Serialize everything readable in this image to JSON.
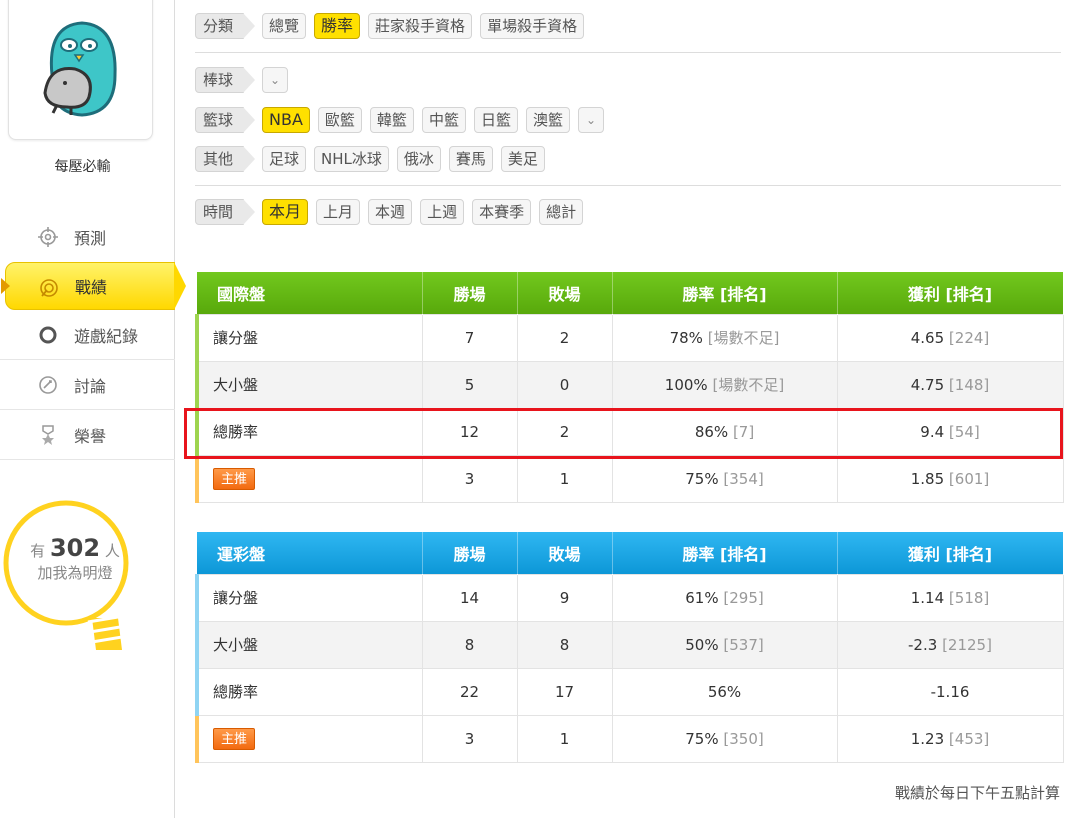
{
  "sidebar": {
    "username": "每壓必輸",
    "nav": [
      {
        "label": "預測",
        "icon": "crosshair-icon"
      },
      {
        "label": "戰績",
        "icon": "trophy-target-icon",
        "active": true
      },
      {
        "label": "遊戲紀錄",
        "icon": "circle-icon"
      },
      {
        "label": "討論",
        "icon": "chat-bubble-icon"
      },
      {
        "label": "榮譽",
        "icon": "medal-icon"
      }
    ],
    "bulb": {
      "prefix": "有",
      "count": "302",
      "suffix": "人",
      "line2": "加我為明燈"
    }
  },
  "filters": {
    "category": {
      "label": "分類",
      "chips": [
        "總覽",
        "勝率",
        "莊家殺手資格",
        "單場殺手資格"
      ],
      "selected": "勝率"
    },
    "baseball": {
      "label": "棒球"
    },
    "basketball": {
      "label": "籃球",
      "chips": [
        "NBA",
        "歐籃",
        "韓籃",
        "中籃",
        "日籃",
        "澳籃"
      ],
      "selected": "NBA"
    },
    "other": {
      "label": "其他",
      "chips": [
        "足球",
        "NHL冰球",
        "俄冰",
        "賽馬",
        "美足"
      ]
    },
    "time": {
      "label": "時間",
      "chips": [
        "本月",
        "上月",
        "本週",
        "上週",
        "本賽季",
        "總計"
      ],
      "selected": "本月"
    }
  },
  "colors": {
    "accent_yellow": "#ffe000",
    "green_header": "#5fb412",
    "blue_header": "#18a5e3",
    "highlight_red": "#e8141c"
  },
  "international": {
    "headers": [
      "國際盤",
      "勝場",
      "敗場",
      "勝率 [排名]",
      "獲利 [排名]"
    ],
    "rows": [
      {
        "name": "讓分盤",
        "win": "7",
        "loss": "2",
        "rate": "78%",
        "rate_rank": "[場數不足]",
        "profit": "4.65",
        "profit_rank": "[224]"
      },
      {
        "name": "大小盤",
        "win": "5",
        "loss": "0",
        "rate": "100%",
        "rate_rank": "[場數不足]",
        "profit": "4.75",
        "profit_rank": "[148]"
      },
      {
        "name": "總勝率",
        "win": "12",
        "loss": "2",
        "rate": "86%",
        "rate_rank": "[7]",
        "profit": "9.4",
        "profit_rank": "[54]"
      }
    ],
    "main_pick": {
      "badge": "主推",
      "win": "3",
      "loss": "1",
      "rate": "75%",
      "rate_rank": "[354]",
      "profit": "1.85",
      "profit_rank": "[601]"
    }
  },
  "sports_lottery": {
    "headers": [
      "運彩盤",
      "勝場",
      "敗場",
      "勝率 [排名]",
      "獲利 [排名]"
    ],
    "rows": [
      {
        "name": "讓分盤",
        "win": "14",
        "loss": "9",
        "rate": "61%",
        "rate_rank": "[295]",
        "profit": "1.14",
        "profit_rank": "[518]"
      },
      {
        "name": "大小盤",
        "win": "8",
        "loss": "8",
        "rate": "50%",
        "rate_rank": "[537]",
        "profit": "-2.3",
        "profit_rank": "[2125]"
      },
      {
        "name": "總勝率",
        "win": "22",
        "loss": "17",
        "rate": "56%",
        "rate_rank": "",
        "profit": "-1.16",
        "profit_rank": ""
      }
    ],
    "main_pick": {
      "badge": "主推",
      "win": "3",
      "loss": "1",
      "rate": "75%",
      "rate_rank": "[350]",
      "profit": "1.23",
      "profit_rank": "[453]"
    }
  },
  "footnote": "戰績於每日下午五點計算"
}
